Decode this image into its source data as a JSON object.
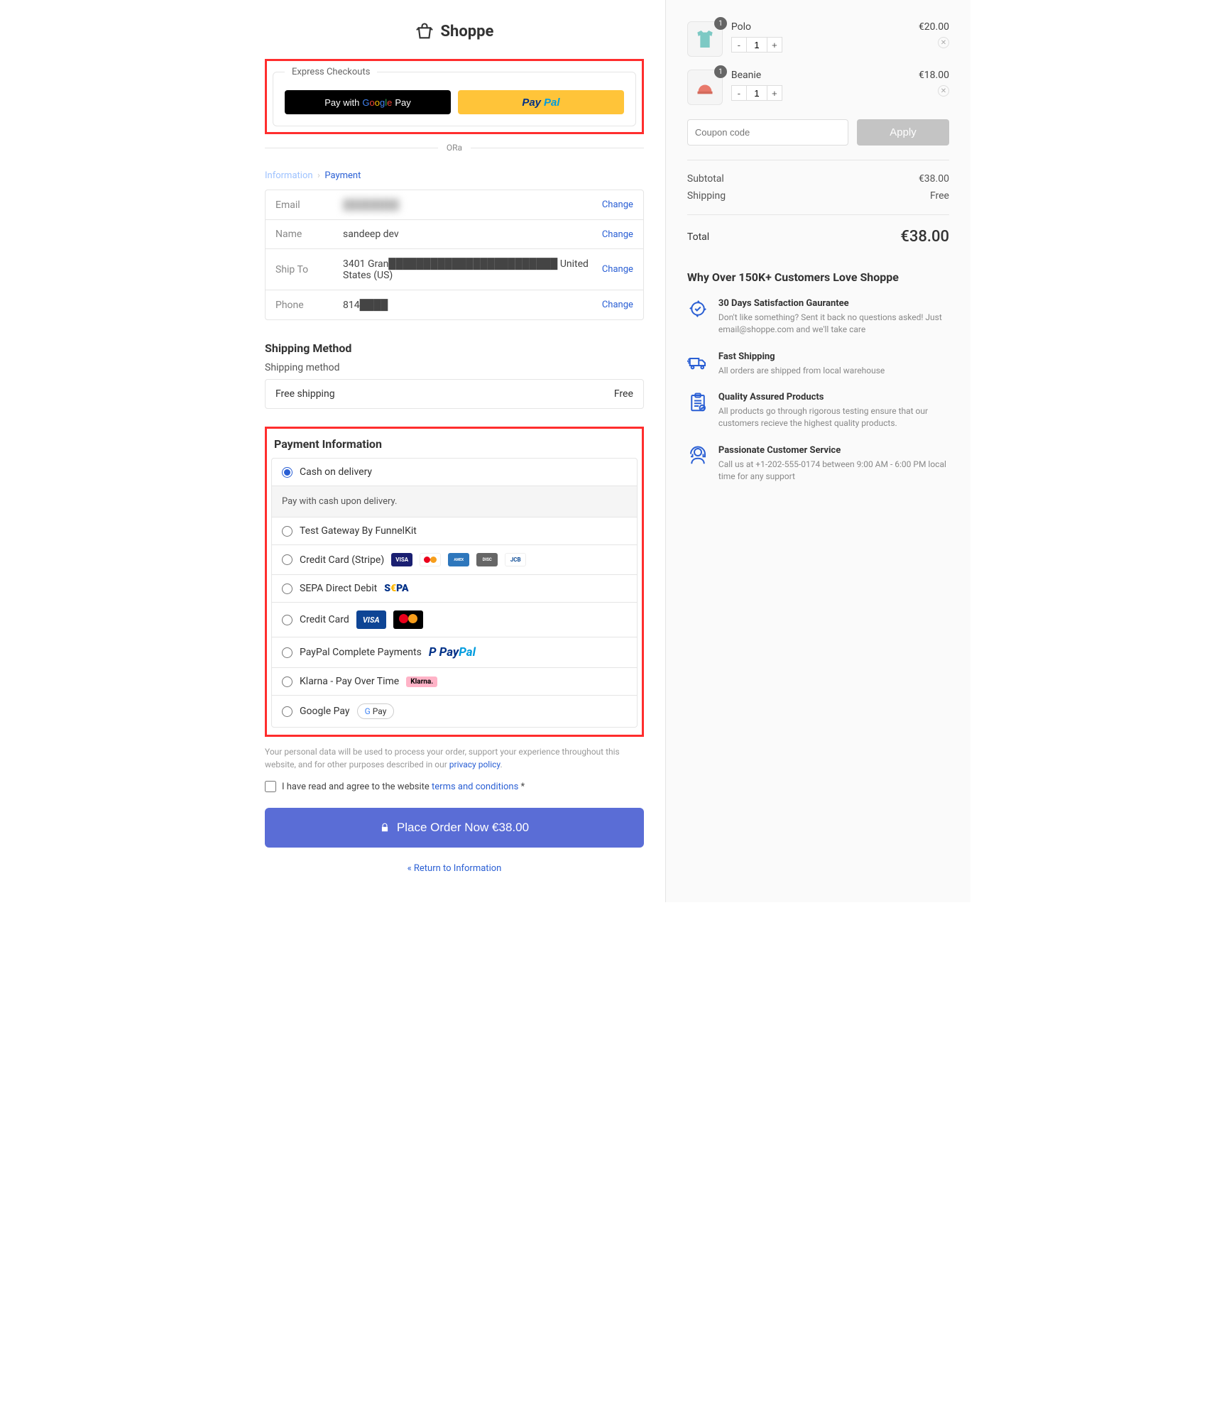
{
  "brand": "Shoppe",
  "express": {
    "legend": "Express Checkouts",
    "gpay": "Pay with",
    "or": "ORa"
  },
  "crumbs": {
    "info": "Information",
    "pay": "Payment"
  },
  "info": {
    "email": {
      "label": "Email",
      "value": "████████",
      "change": "Change"
    },
    "name": {
      "label": "Name",
      "value": "sandeep dev",
      "change": "Change"
    },
    "ship": {
      "label": "Ship To",
      "value": "3401 Gran████████████████████████  United States (US)",
      "change": "Change"
    },
    "phone": {
      "label": "Phone",
      "value": "814████",
      "change": "Change"
    }
  },
  "shipping": {
    "heading": "Shipping Method",
    "sub": "Shipping method",
    "option": "Free shipping",
    "price": "Free"
  },
  "payment": {
    "heading": "Payment Information",
    "options": [
      "Cash on delivery",
      "Test Gateway By FunnelKit",
      "Credit Card (Stripe)",
      "SEPA Direct Debit",
      "Credit Card",
      "PayPal Complete Payments",
      "Klarna - Pay Over Time",
      "Google Pay"
    ],
    "desc": "Pay with cash upon delivery."
  },
  "privacy": {
    "text": "Your personal data will be used to process your order, support your experience throughout this website, and for other purposes described in our ",
    "link": "privacy policy"
  },
  "terms": {
    "text": "I have read and agree to the website ",
    "link": "terms and conditions",
    "suffix": " *"
  },
  "placeOrder": "Place Order Now  €38.00",
  "return": "« Return to Information",
  "cart": {
    "items": [
      {
        "name": "Polo",
        "price": "€20.00",
        "qty": "1",
        "badge": "1"
      },
      {
        "name": "Beanie",
        "price": "€18.00",
        "qty": "1",
        "badge": "1"
      }
    ],
    "coupon": {
      "placeholder": "Coupon code",
      "apply": "Apply"
    },
    "subtotal": {
      "label": "Subtotal",
      "value": "€38.00"
    },
    "shipping": {
      "label": "Shipping",
      "value": "Free"
    },
    "total": {
      "label": "Total",
      "value": "€38.00"
    }
  },
  "love": {
    "heading": "Why Over 150K+ Customers Love Shoppe",
    "items": [
      {
        "t": "30 Days Satisfaction Gaurantee",
        "d": "Don't like something? Sent it back no questions asked! Just email@shoppe.com and we'll take care"
      },
      {
        "t": "Fast Shipping",
        "d": "All orders are shipped from local warehouse"
      },
      {
        "t": "Quality Assured Products",
        "d": "All products go through rigorous testing ensure that our customers recieve the highest quality products."
      },
      {
        "t": "Passionate Customer Service",
        "d": "Call us at +1-202-555-0174 between 9:00 AM - 6:00 PM local time for any support"
      }
    ]
  }
}
